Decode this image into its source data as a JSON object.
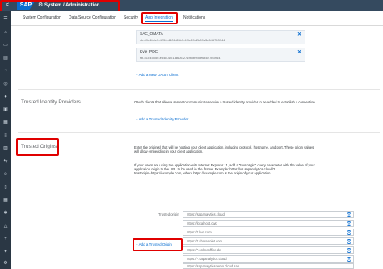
{
  "shell": {
    "back": "<",
    "logo": "SAP",
    "title": "System / Administration"
  },
  "tabs": [
    {
      "label": "System Configuration"
    },
    {
      "label": "Data Source Configuration"
    },
    {
      "label": "Security"
    },
    {
      "label": "App Integration",
      "active": true
    },
    {
      "label": "Notifications"
    }
  ],
  "clients": [
    {
      "name": "SAC_OMATA",
      "id": "sb-49d4b0e5-4250-4406-83b7-4f9e39d2b89a3e6457b3944"
    },
    {
      "name": "Kyle_PDC",
      "id": "sb-51d45550-e54b-4fc1-a60c-271fb0b9d5e64627b3944"
    }
  ],
  "add_oauth_label": "Add a New OAuth Client",
  "trusted_idp": {
    "title": "Trusted Identity Providers",
    "desc": "OAuth clients that allow a server to communicate require a trusted identity provider to be added to establish a connection.",
    "add_label": "Add a Trusted Identity Provider"
  },
  "trusted_origins": {
    "title": "Trusted Origins",
    "desc1": "Enter the origin(s) that will be hosting your client application, including protocol, hostname, and port. These origin values will allow embedding in your client application.",
    "desc2": "If your users are using the application with Internet Explorer 11, add a \"trustorigin\" query parameter with the value of your application origin to the URL to be used in the iframe. Example: https://us.sapanalytics.cloud/?trustorigin=https://example.com, where https://example.com is the origin of your application.",
    "label": "Trusted origin",
    "origins": [
      "https://sapanalytics.cloud",
      "https://localhost.cwp",
      "https://*.live.com",
      "https://*.sharepoint.com",
      "https://*.onlineoffice.de",
      "https://*.sapanalytics.cloud",
      "https://sapanalyticsdemo.cloud.sap"
    ],
    "add_label": "Add a Trusted Origin"
  },
  "rail_icons": [
    "home-icon",
    "search-icon",
    "file-icon",
    "chart-icon",
    "compass-icon",
    "person-icon",
    "box-icon",
    "grid-icon",
    "list-icon",
    "calendar-icon",
    "share-icon",
    "people-icon",
    "document-icon",
    "table-icon",
    "settings-icon",
    "arrow-icon",
    "plus-icon",
    "magic-icon",
    "gear-icon"
  ]
}
